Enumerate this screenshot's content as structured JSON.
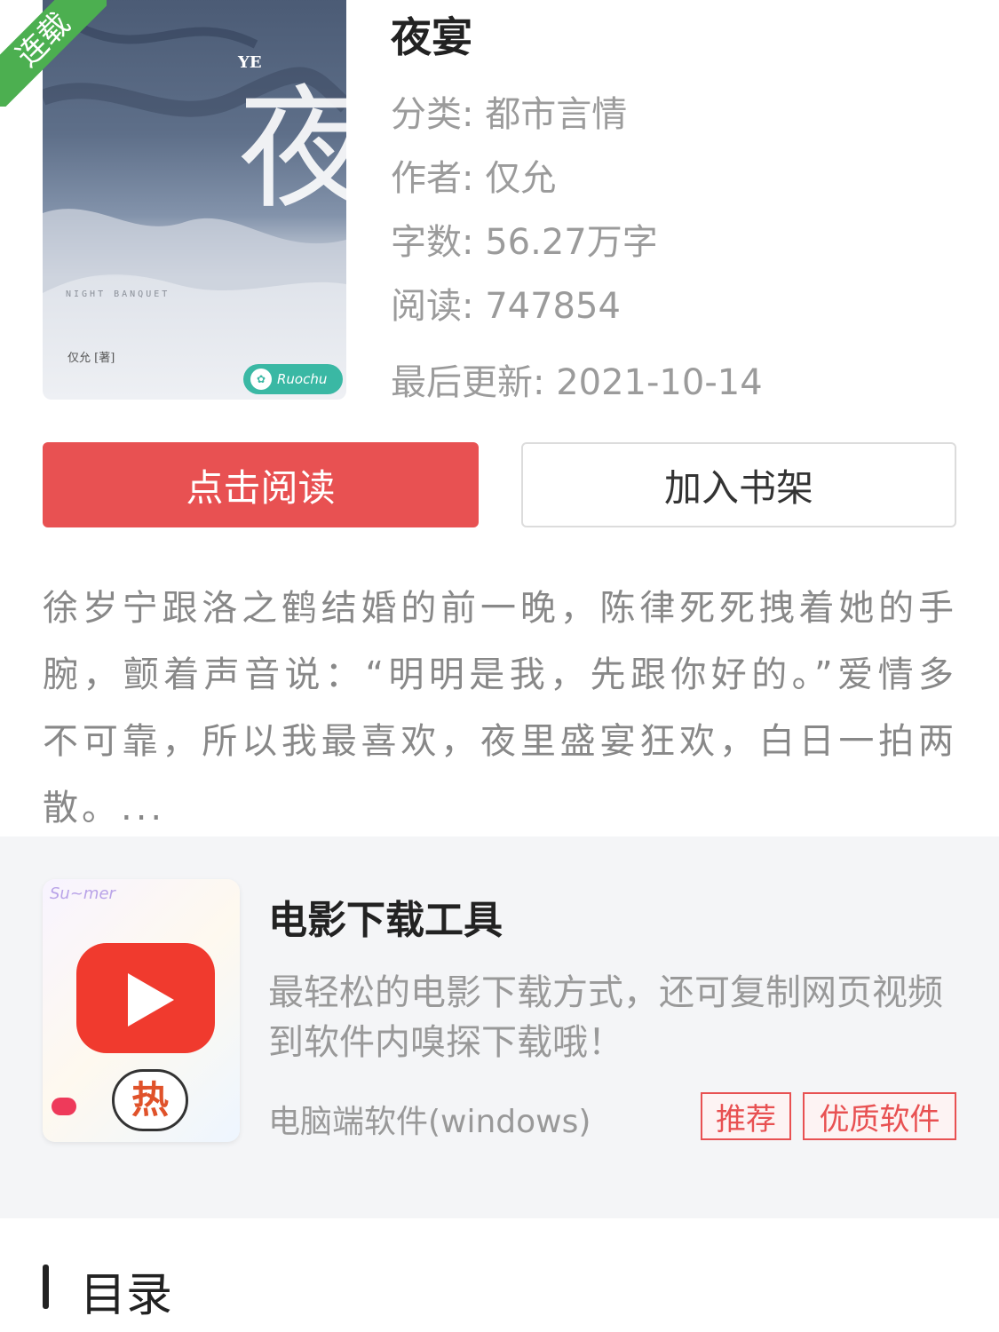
{
  "book": {
    "status_ribbon": "连载",
    "title": "夜宴",
    "category_label": "分类:",
    "category": "都市言情",
    "author_label": "作者:",
    "author": "仅允",
    "word_count_label": "字数:",
    "word_count": "56.27万字",
    "reads_label": "阅读:",
    "reads": "747854",
    "updated_label": "最后更新:",
    "updated": "2021-10-14",
    "cover": {
      "big_title": "夜宴",
      "latin": "YE",
      "subtitle_en": "NIGHT  BANQUET",
      "cover_author": "仅允 [著]",
      "publisher_logo": "Ruochu"
    }
  },
  "actions": {
    "read_label": "点击阅读",
    "shelf_label": "加入书架"
  },
  "description": "徐岁宁跟洛之鹤结婚的前一晚，陈律死死拽着她的手腕，颤着声音说：“明明是我，先跟你好的。”爱情多不可靠，所以我最喜欢，夜里盛宴狂欢，白日一拍两散。...",
  "ad": {
    "title": "电影下载工具",
    "description": "最轻松的电影下载方式，还可复制网页视频到软件内嗅探下载哦！",
    "platform": "电脑端软件(windows)",
    "tags": [
      "推荐",
      "优质软件"
    ],
    "icon_badge": "热"
  },
  "catalog": {
    "title": "目录"
  },
  "colors": {
    "primary_red": "#e85152",
    "ribbon_green": "#4caf50",
    "muted_text": "#9b9b9b"
  }
}
